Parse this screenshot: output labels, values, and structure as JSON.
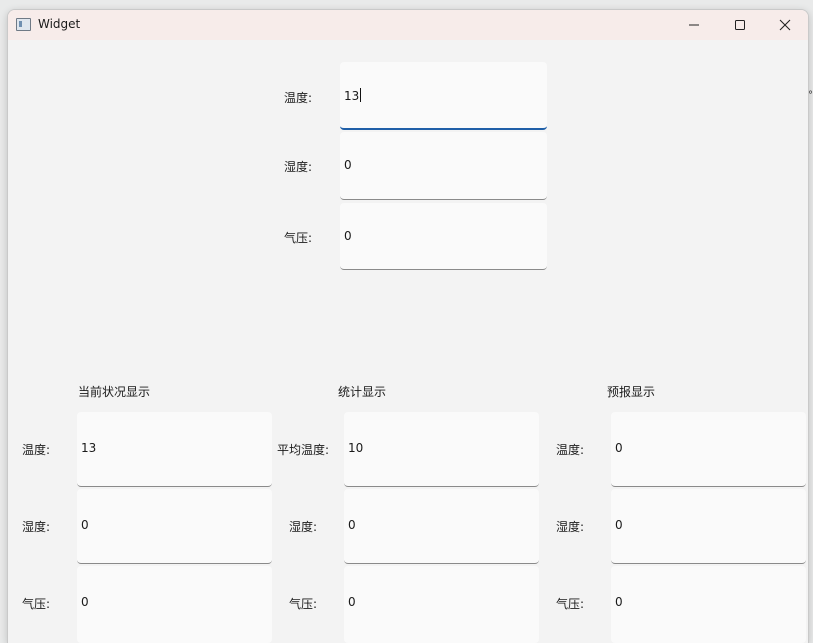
{
  "window": {
    "title": "Widget",
    "icon": "app-window-icon",
    "controls": {
      "minimize": "minimize-icon",
      "maximize": "maximize-icon",
      "close": "close-icon"
    }
  },
  "input": {
    "temperature": {
      "label": "温度:",
      "value": "13"
    },
    "humidity": {
      "label": "湿度:",
      "value": "0"
    },
    "pressure": {
      "label": "气压:",
      "value": "0"
    }
  },
  "current": {
    "title": "当前状况显示",
    "temperature": {
      "label": "温度:",
      "value": "13"
    },
    "humidity": {
      "label": "湿度:",
      "value": "0"
    },
    "pressure": {
      "label": "气压:",
      "value": "0"
    }
  },
  "statistics": {
    "title": "统计显示",
    "avg_temperature": {
      "label": "平均温度:",
      "value": "10"
    },
    "humidity": {
      "label": "湿度:",
      "value": "0"
    },
    "pressure": {
      "label": "气压:",
      "value": "0"
    }
  },
  "forecast": {
    "title": "预报显示",
    "temperature": {
      "label": "温度:",
      "value": "0"
    },
    "humidity": {
      "label": "湿度:",
      "value": "0"
    },
    "pressure": {
      "label": "气压:",
      "value": "0"
    }
  },
  "colors": {
    "accent": "#1f5fa8",
    "titlebar": "#f7ecea",
    "window_bg": "#f3f3f3",
    "field_bg": "#fafafa"
  }
}
